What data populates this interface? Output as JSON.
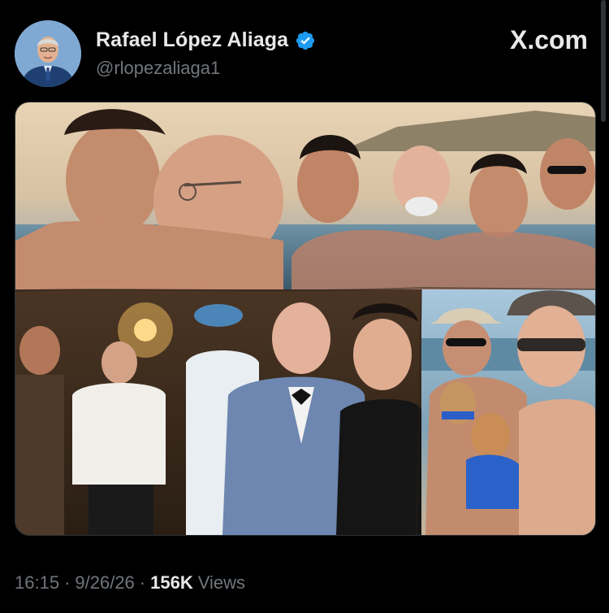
{
  "post": {
    "author": {
      "display_name": "Rafael López Aliaga",
      "handle": "@rlopezaliaga1",
      "verified": true
    },
    "brand_label": "X.com",
    "brand_icon": "x-logo-icon",
    "media": {
      "type": "photo-collage",
      "panels": [
        "hot-tub-kiss-photo",
        "hot-tub-group-photo",
        "party-photo",
        "beach-dogs-photo"
      ]
    },
    "meta": {
      "time": "16:15",
      "separator": "·",
      "date": "9/26/26",
      "views_count": "156K",
      "views_label": "Views"
    }
  },
  "colors": {
    "background": "#000000",
    "primary_text": "#e7e9ea",
    "secondary_text": "#71767b",
    "verified_blue": "#1d9bf0",
    "border": "#2f3336"
  }
}
